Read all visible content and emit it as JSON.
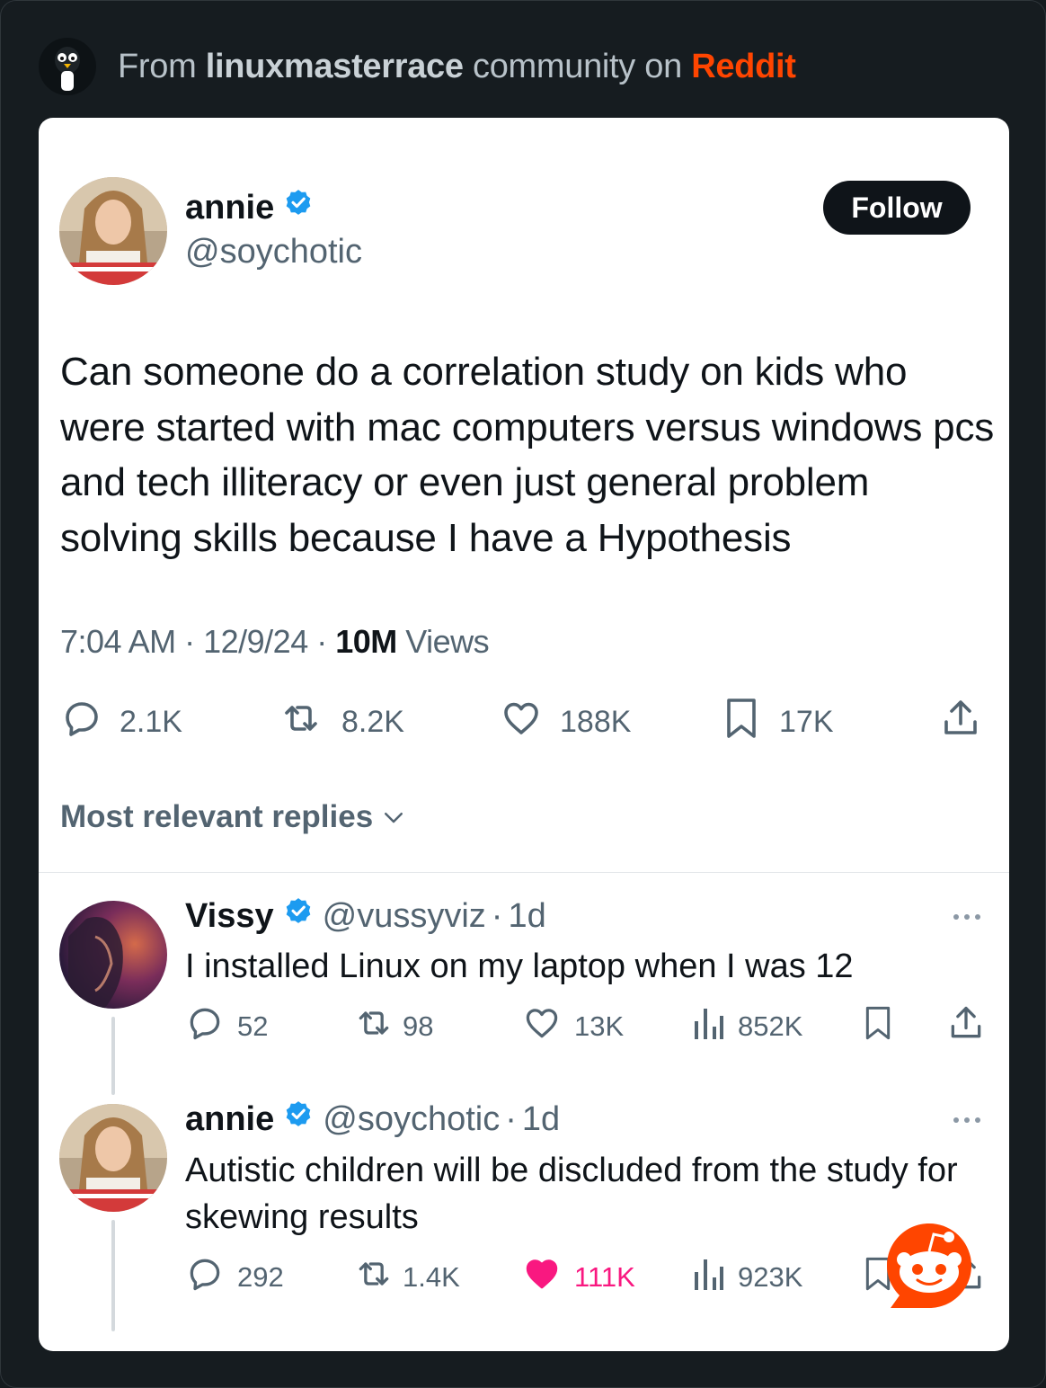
{
  "header": {
    "prefix": "From",
    "community": "linuxmasterrace",
    "middle": "community on",
    "site": "Reddit",
    "icons": {
      "community_avatar": "penguin-icon",
      "site_logo": "reddit-snoo-icon"
    }
  },
  "tweet": {
    "author": {
      "name": "annie",
      "handle": "@soychotic",
      "verified": true
    },
    "follow_label": "Follow",
    "text": "Can someone do a correlation study on kids who were started with mac computers versus windows pcs and tech illiteracy or even just general problem solving skills because I have a Hypothesis",
    "time": "7:04 AM",
    "date": "12/9/24",
    "views_count": "10M",
    "views_label": "Views",
    "stats": {
      "replies": "2.1K",
      "reposts": "8.2K",
      "likes": "188K",
      "bookmarks": "17K"
    }
  },
  "sort_label": "Most relevant replies",
  "replies": [
    {
      "name": "Vissy",
      "handle": "@vussyviz",
      "age": "1d",
      "verified": true,
      "text": "I installed Linux on my laptop when I was 12",
      "stats": {
        "replies": "52",
        "reposts": "98",
        "likes": "13K",
        "views": "852K"
      },
      "liked": false
    },
    {
      "name": "annie",
      "handle": "@soychotic",
      "age": "1d",
      "verified": true,
      "text": "Autistic children will be discluded from the study for skewing results",
      "stats": {
        "replies": "292",
        "reposts": "1.4K",
        "likes": "111K",
        "views": "923K"
      },
      "liked": true
    }
  ],
  "colors": {
    "background": "#151b1f",
    "card": "#ffffff",
    "reddit_orange": "#ff4500",
    "verified_blue": "#1d9bf0",
    "like_pink": "#f91880",
    "secondary_text": "#536471",
    "primary_text": "#0f1419"
  }
}
